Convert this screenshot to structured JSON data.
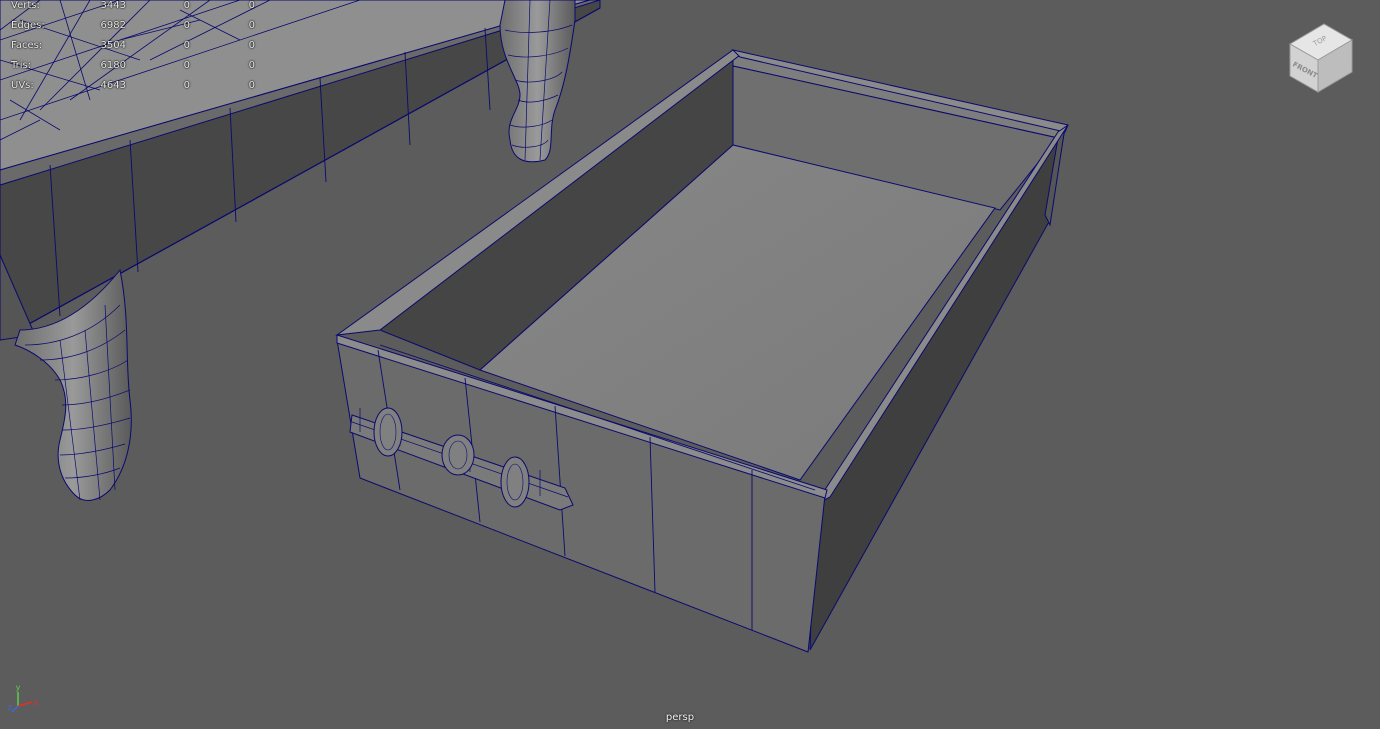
{
  "hud": {
    "rows": [
      {
        "label": "Verts:",
        "v1": "3443",
        "v2": "0",
        "v3": "0"
      },
      {
        "label": "Edges:",
        "v1": "6982",
        "v2": "0",
        "v3": "0"
      },
      {
        "label": "Faces:",
        "v1": "3504",
        "v2": "0",
        "v3": "0"
      },
      {
        "label": "Tris:",
        "v1": "6180",
        "v2": "0",
        "v3": "0"
      },
      {
        "label": "UVs:",
        "v1": "4643",
        "v2": "0",
        "v3": "0"
      }
    ]
  },
  "viewport": {
    "camera_name": "persp",
    "background_color": "#5c5c5c",
    "wireframe_color": "#0a0a6e",
    "view_cube": {
      "top_label": "TOP",
      "front_label": "FRONT"
    },
    "axis_gizmo": {
      "x_label": "x",
      "y_label": "y",
      "z_label": "z",
      "x_color": "#e0302a",
      "y_color": "#5ad04a",
      "z_color": "#3a6ae0"
    }
  }
}
